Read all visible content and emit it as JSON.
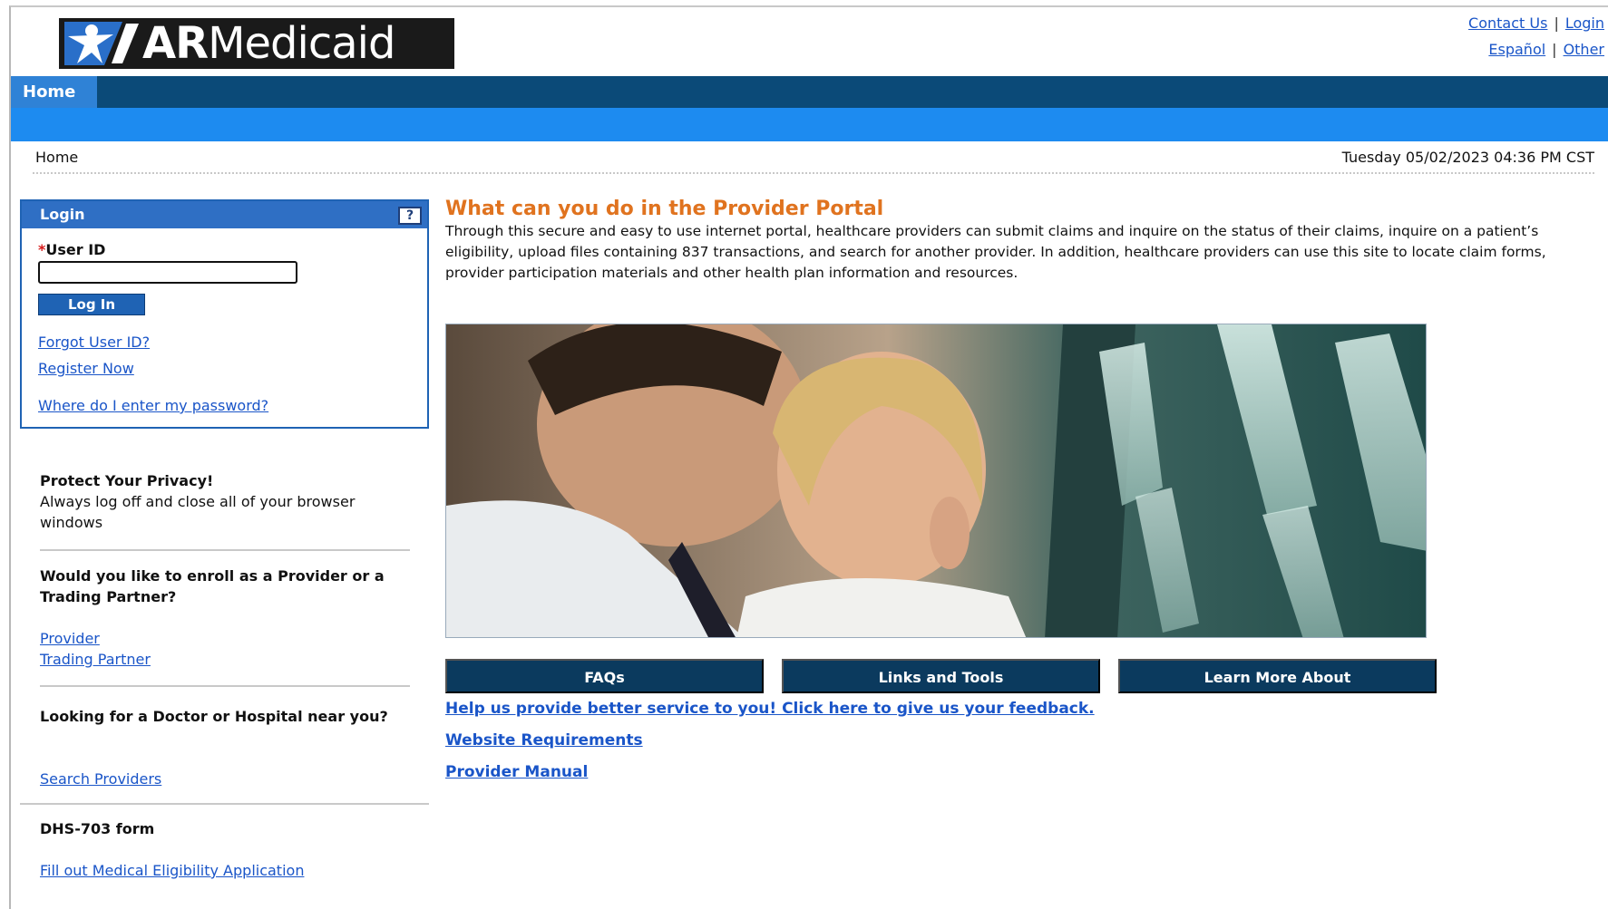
{
  "header": {
    "logo_text_bold": "AR",
    "logo_text_regular": "Medicaid",
    "links_row1": [
      "Contact Us",
      "Login"
    ],
    "links_row2": [
      "Español",
      "Other"
    ],
    "separator": "|"
  },
  "nav": {
    "home_tab": "Home"
  },
  "breadcrumb": {
    "current": "Home",
    "datetime": "Tuesday 05/02/2023 04:36 PM CST"
  },
  "login": {
    "title": "Login",
    "help_label": "?",
    "required_mark": "*",
    "userid_label": "User ID",
    "userid_value": "",
    "login_button": "Log In",
    "forgot_link": "Forgot User ID?",
    "register_link": "Register Now",
    "password_link": "Where do I enter my password?"
  },
  "sidebar": {
    "privacy_title": "Protect Your Privacy!",
    "privacy_text": "Always log off and close all of your browser windows",
    "enroll_title": "Would you like to enroll as a Provider or a Trading Partner?",
    "enroll_links": [
      "Provider",
      "Trading Partner"
    ],
    "doctor_title": "Looking for a Doctor or Hospital near you?",
    "doctor_link": "Search Providers",
    "form_title": "DHS-703 form",
    "form_link": "Fill out Medical Eligibility Application"
  },
  "main": {
    "title": "What can you do in the Provider Portal",
    "intro": "Through this secure and easy to use internet portal, healthcare providers can submit claims and inquire on the status of their claims, inquire on a patient’s eligibility, upload files containing 837 transactions, and search for another provider. In addition, healthcare providers can use this site to locate claim forms, provider participation materials and other health plan information and resources.",
    "tabs": [
      "FAQs",
      "Links and Tools",
      "Learn More About"
    ],
    "links": [
      "Help us provide better service to you! Click here to give us your feedback.",
      "Website Requirements",
      "Provider Manual"
    ]
  },
  "colors": {
    "nav_dark": "#0b4a78",
    "nav_light": "#1d8bf0",
    "title_orange": "#e0731f",
    "tab_navy": "#0b3a5e",
    "link_blue": "#1a55c8"
  }
}
